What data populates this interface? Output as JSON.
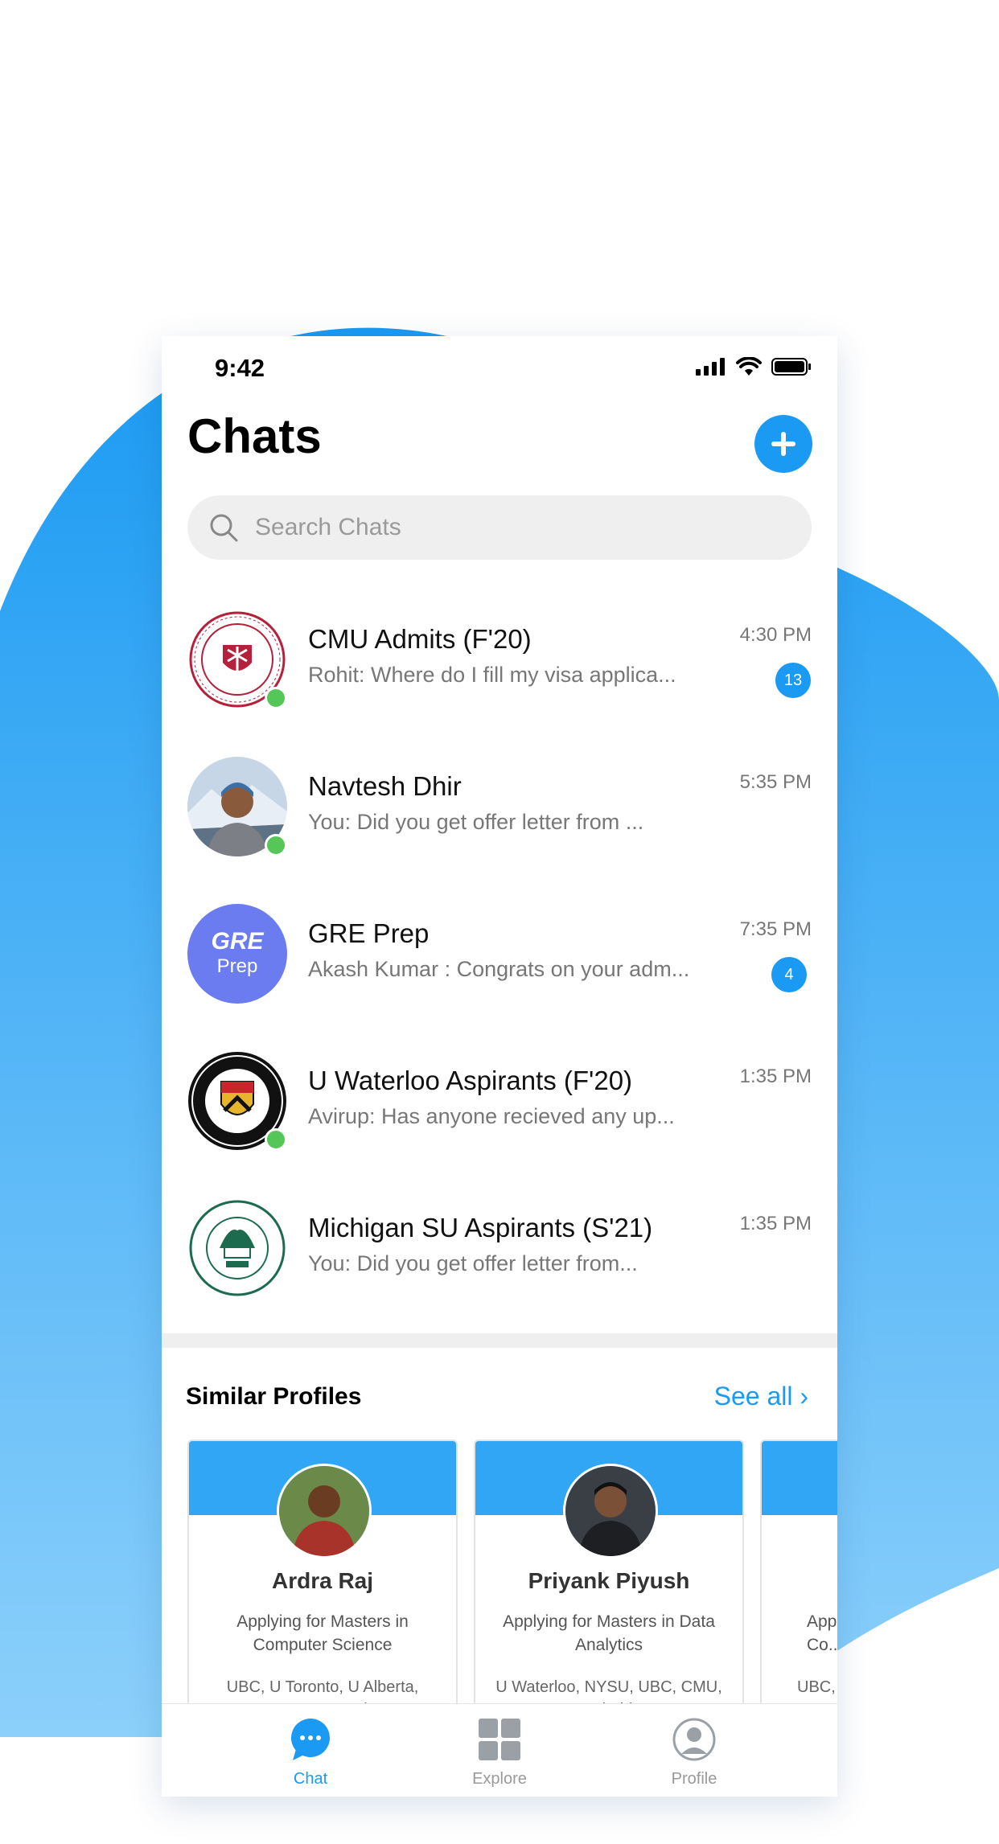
{
  "status_bar": {
    "time": "9:42"
  },
  "header": {
    "title": "Chats",
    "new_chat_icon": "plus-icon"
  },
  "search": {
    "placeholder": "Search Chats"
  },
  "chats": [
    {
      "name": "CMU Admits (F'20)",
      "preview": "Rohit: Where do I fill my visa applica...",
      "time": "4:30 PM",
      "unread": "13",
      "online": true,
      "avatar": "cmu-seal"
    },
    {
      "name": "Navtesh Dhir",
      "preview": "You: Did you get offer letter from ...",
      "time": "5:35 PM",
      "unread": "",
      "online": true,
      "avatar": "person-photo"
    },
    {
      "name": "GRE Prep",
      "preview": "Akash Kumar : Congrats on your adm...",
      "time": "7:35 PM",
      "unread": "4",
      "online": false,
      "avatar": "gre-prep",
      "avatar_line1": "GRE",
      "avatar_line2": "Prep"
    },
    {
      "name": "U Waterloo Aspirants (F'20)",
      "preview": "Avirup: Has anyone recieved any up...",
      "time": "1:35 PM",
      "unread": "",
      "online": true,
      "avatar": "waterloo-seal"
    },
    {
      "name": "Michigan SU Aspirants (S'21)",
      "preview": "You: Did you get offer letter from...",
      "time": "1:35 PM",
      "unread": "",
      "online": false,
      "avatar": "msu-seal"
    }
  ],
  "similar_profiles": {
    "title": "Similar Profiles",
    "see_all": "See all ›",
    "cards": [
      {
        "name": "Ardra Raj",
        "description": "Applying for Masters in Computer Science",
        "universities": "UBC, U Toronto, U Alberta, CMU, U Waterloo"
      },
      {
        "name": "Priyank Piyush",
        "description": "Applying for Masters in Data Analytics",
        "universities": "U Waterloo, NYSU, UBC, CMU, U Florida"
      },
      {
        "name": "",
        "description": "Appl... Co...",
        "universities": "UBC, ... C..."
      }
    ]
  },
  "tabbar": {
    "tabs": [
      {
        "label": "Chat",
        "icon": "chat-bubble-icon",
        "active": true
      },
      {
        "label": "Explore",
        "icon": "grid-icon",
        "active": false
      },
      {
        "label": "Profile",
        "icon": "user-circle-icon",
        "active": false
      }
    ]
  },
  "colors": {
    "accent": "#1a9af2",
    "online": "#55c658",
    "gre_avatar": "#6b7cf0",
    "card_header": "#30a6f5"
  }
}
